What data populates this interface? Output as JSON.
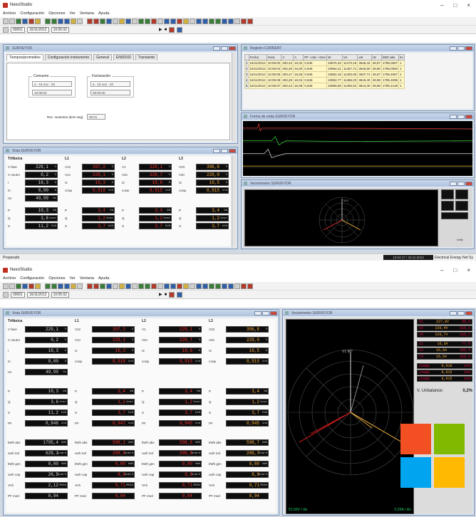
{
  "app": {
    "title": "NexoStudio",
    "window_controls": [
      "–",
      "□",
      "×"
    ]
  },
  "menu": [
    "Archivo",
    "Configuración",
    "Opciones",
    "Ver",
    "Ventana",
    "Ayuda"
  ],
  "toolbar2": {
    "id_value": "00001",
    "date_value": "16/11/2012",
    "time_value": "10:05:02"
  },
  "top": {
    "config_window": {
      "title": "SURVEYOR",
      "tabs": [
        "Tiempos/promedios",
        "Configuración instrumento",
        "General",
        "EN50160",
        "Transiente"
      ],
      "group_consumo": "Consumo",
      "group_facturacion": "Facturación",
      "consumo_sel": "a - 16 nov - 20",
      "consumo_time": "10:05:02",
      "fact_sel": "a - 16 nov - 20",
      "fact_time": "08:00:00",
      "muestreo_label": "Rec. muestreo (tiem seg)",
      "muestreo_value": "00:01"
    },
    "table_window": {
      "title": "Registro CURRENT",
      "headers": [
        "Fecha",
        "Hora",
        "V",
        "A",
        "PF +Abc +Gen",
        "W",
        "VA",
        "var",
        "Hz",
        "kWh abs",
        "kv"
      ],
      "rows": [
        [
          "1",
          "16/11/2012",
          "10:05:02",
          "293,42",
          "16,02",
          "0,946",
          "10875,32",
          "11473,16",
          "3648,42",
          "49,97",
          "1795,0067",
          "1"
        ],
        [
          "2",
          "16/11/2012",
          "10:05:04",
          "293,48",
          "16,00",
          "0,946",
          "10864,21",
          "11467,71",
          "3646,90",
          "49,96",
          "1795,0050",
          "1"
        ],
        [
          "3",
          "16/11/2012",
          "10:05:05",
          "293,47",
          "16,06",
          "0,946",
          "10852,18",
          "11493,05",
          "3637,74",
          "49,97",
          "1795,4067",
          "1"
        ],
        [
          "4",
          "16/11/2012",
          "10:05:06",
          "293,28",
          "16,04",
          "0,946",
          "10852,77",
          "11486,20",
          "3618,40",
          "49,98",
          "1795,4095",
          "1"
        ],
        [
          "5",
          "16/11/2012",
          "10:05:07",
          "293,44",
          "16,05",
          "0,946",
          "10859,59",
          "11493,52",
          "3613,30",
          "49,98",
          "1795,4135",
          "1"
        ]
      ]
    },
    "wave_window": {
      "title": "Forma de onda SURVEYOR"
    },
    "phasor_window": {
      "title": "Vectorimetro SURVEYOR",
      "label": "VL1",
      "scale_label": "V/div"
    },
    "meas_window": {
      "title": "Vista SURVEYOR"
    },
    "status": {
      "left": "Preparado",
      "right_dark": "10:04:17 / 16:11:2012",
      "right_text": "Electrical Energy Net Sy"
    }
  },
  "bottom": {
    "meas_window": {
      "title": "Vista SURVEYOR"
    },
    "phasor_window": {
      "title": "Vectorimetro SURVEYOR",
      "unbalance_label": "V. Unbalance:",
      "unbalance_value": "0,2%",
      "bottom_left": "51,50V / div",
      "bottom_right": "0,25A / div",
      "axis_top": "V1 90°"
    },
    "phasor_values": [
      {
        "l": "V1",
        "v": "227,0V",
        "a": "90,0"
      },
      {
        "l": "V2",
        "v": "226,4V",
        "a": "210,1"
      },
      {
        "l": "V3",
        "v": "226,7V",
        "a": "330,2"
      },
      {
        "l": "I1",
        "v": "16,3A",
        "a": "77,8"
      },
      {
        "l": "I2",
        "v": "16,6A",
        "a": "196,4"
      },
      {
        "l": "I3",
        "v": "16,5A",
        "a": "318,3"
      },
      {
        "l": "cosφ1",
        "v": "0,918",
        "a": "ind"
      },
      {
        "l": "cosφ2",
        "v": "0,915",
        "a": "ind"
      },
      {
        "l": "cosφ3",
        "v": "0,915",
        "a": "ind"
      }
    ]
  },
  "meas": {
    "col_headers": [
      "Trifásica",
      "L1",
      "L2",
      "L3"
    ],
    "blocks": [
      [
        [
          {
            "l": "V fase",
            "v": "229,1",
            "u": "V"
          },
          {
            "l": "V12",
            "v": "397,2",
            "u": "V"
          },
          {
            "l": "V1",
            "v": "229,1",
            "u": "V"
          },
          {
            "l": "V23",
            "v": "396,8",
            "u": "V"
          }
        ],
        [
          {
            "l": "V neutro",
            "v": "0,2",
            "u": "V"
          },
          {
            "l": "V1n",
            "v": "229,1",
            "u": "V"
          },
          {
            "l": "V2n",
            "v": "228,7",
            "u": "V"
          },
          {
            "l": "V3n",
            "v": "229,0",
            "u": "V"
          }
        ],
        [
          {
            "l": "I",
            "v": "16,3",
            "u": "A"
          },
          {
            "l": "I1",
            "v": "16,3",
            "u": "A"
          },
          {
            "l": "I2",
            "v": "16,6",
            "u": "A"
          },
          {
            "l": "I3",
            "v": "16,5",
            "u": "A"
          }
        ],
        [
          {
            "l": "In",
            "v": "0,00",
            "u": "A"
          },
          {
            "l": "cosφ",
            "v": "0,918",
            "u": "ind"
          },
          {
            "l": "cosφ",
            "v": "0,915",
            "u": "ind"
          },
          {
            "l": "cosφ",
            "v": "0,915",
            "u": "ind"
          }
        ],
        [
          {
            "l": "Hz",
            "v": "49,99",
            "u": "Hz"
          },
          {
            "l": "",
            "v": "",
            "u": ""
          },
          {
            "l": "",
            "v": "",
            "u": ""
          },
          {
            "l": "",
            "v": "",
            "u": ""
          }
        ]
      ],
      [
        [
          {
            "l": "P",
            "v": "10,3",
            "u": "kW"
          },
          {
            "l": "P",
            "v": "3,4",
            "u": "kW"
          },
          {
            "l": "P",
            "v": "3,4",
            "u": "kW"
          },
          {
            "l": "P",
            "v": "3,4",
            "u": "kW"
          }
        ],
        [
          {
            "l": "Q",
            "v": "3,6",
            "u": "kvar"
          },
          {
            "l": "Q",
            "v": "1,2",
            "u": "kvar"
          },
          {
            "l": "Q",
            "v": "1,2",
            "u": "kvar"
          },
          {
            "l": "Q",
            "v": "1,2",
            "u": "kvar"
          }
        ],
        [
          {
            "l": "S",
            "v": "11,2",
            "u": "kVA"
          },
          {
            "l": "S",
            "v": "3,7",
            "u": "kVA"
          },
          {
            "l": "S",
            "v": "3,7",
            "u": "kVA"
          },
          {
            "l": "S",
            "v": "3,7",
            "u": "kVA"
          }
        ],
        [
          {
            "l": "PF",
            "v": "0,946",
            "u": "ind"
          },
          {
            "l": "PF",
            "v": "0,947",
            "u": "ind"
          },
          {
            "l": "PF",
            "v": "0,945",
            "u": "ind"
          },
          {
            "l": "PF",
            "v": "0,945",
            "u": "ind"
          }
        ]
      ],
      [
        [
          {
            "l": "kWh abs",
            "v": "1795,4",
            "u": "kWh"
          },
          {
            "l": "kWh abs",
            "v": "598,1",
            "u": "kWh"
          },
          {
            "l": "kWh abs",
            "v": "598,6",
            "u": "kWh"
          },
          {
            "l": "kWh abs",
            "v": "598,7",
            "u": "kWh"
          }
        ],
        [
          {
            "l": "varh ind",
            "v": "629,1",
            "u": "kvarh"
          },
          {
            "l": "varh ind",
            "v": "209,6",
            "u": "kvarh"
          },
          {
            "l": "varh ind",
            "v": "209,8",
            "u": "kvarh"
          },
          {
            "l": "varh ind",
            "v": "209,7",
            "u": "kvarh"
          }
        ],
        [
          {
            "l": "kWh gen",
            "v": "0,00",
            "u": "kWh"
          },
          {
            "l": "kWh gen",
            "v": "0,00",
            "u": "kWh"
          },
          {
            "l": "kWh gen",
            "v": "0,00",
            "u": "kWh"
          },
          {
            "l": "kWh gen",
            "v": "0,00",
            "u": "kWh"
          }
        ],
        [
          {
            "l": "varh cap",
            "v": "26,5",
            "u": "kvarh"
          },
          {
            "l": "varh cap",
            "v": "8,8",
            "u": "kvarh"
          },
          {
            "l": "varh cap",
            "v": "8,8",
            "u": "kvarh"
          },
          {
            "l": "varh cap",
            "v": "8,9",
            "u": "kvarh"
          }
        ],
        [
          {
            "l": "VAh",
            "v": "2,12",
            "u": "MVAh"
          },
          {
            "l": "VAh",
            "v": "0,71",
            "u": "MVAh"
          },
          {
            "l": "VAh",
            "v": "0,71",
            "u": "MVAh"
          },
          {
            "l": "VAh",
            "v": "0,71",
            "u": "MVAh"
          }
        ],
        [
          {
            "l": "PF med",
            "v": "0,94",
            "u": ""
          },
          {
            "l": "PF med",
            "v": "0,94",
            "u": ""
          },
          {
            "l": "PF med",
            "v": "0,94",
            "u": ""
          },
          {
            "l": "PF med",
            "v": "0,94",
            "u": ""
          }
        ]
      ]
    ]
  },
  "colors": {
    "mdi_bg": "#cfd8e3",
    "display_bg": "#0d0d0d",
    "value_red": "#ff3030",
    "value_orange": "#ffb040",
    "row_yellow": "#fff6c4"
  },
  "logo": {
    "colors": [
      "#f25022",
      "#7fba00",
      "#00a4ef",
      "#ffb900"
    ]
  }
}
